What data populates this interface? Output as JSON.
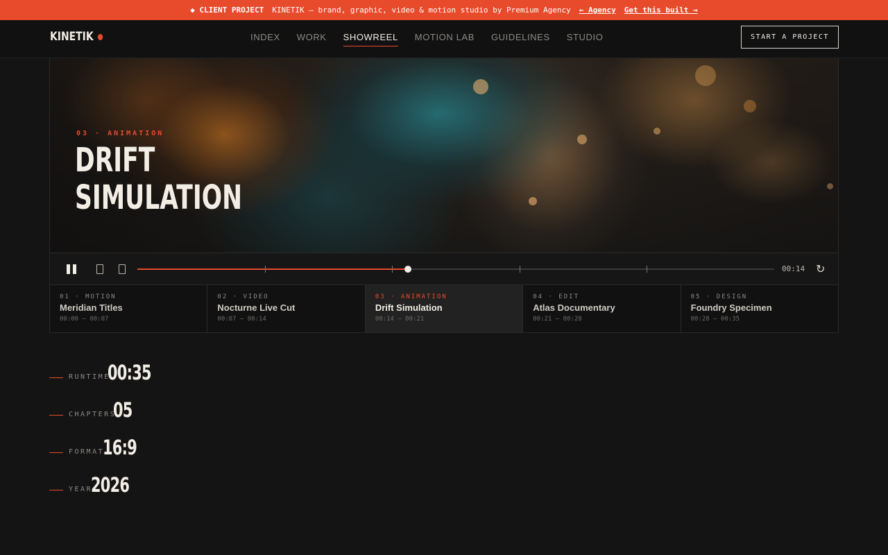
{
  "banner": {
    "tag": "◆ CLIENT PROJECT",
    "text": "KINETIK — brand, graphic, video & motion studio by Premium Agency",
    "back_link": "← Agency",
    "cta_link": "Get this built →"
  },
  "header": {
    "logo": "KINETIK",
    "nav": [
      "INDEX",
      "WORK",
      "SHOWREEL",
      "MOTION LAB",
      "GUIDELINES",
      "STUDIO"
    ],
    "active_nav": "SHOWREEL",
    "cta": "START A PROJECT"
  },
  "hero": {
    "kicker": "03 · ANIMATION",
    "title_line1": "DRIFT",
    "title_line2": "SIMULATION"
  },
  "player": {
    "timecode": "00:14",
    "loop_icon": "↻",
    "progress_fraction": 0.425
  },
  "chapters": [
    {
      "kicker": "01 · MOTION",
      "title": "Meridian Titles",
      "range": "00:00 — 00:07"
    },
    {
      "kicker": "02 · VIDEO",
      "title": "Nocturne Live Cut",
      "range": "00:07 — 00:14"
    },
    {
      "kicker": "03 · ANIMATION",
      "title": "Drift Simulation",
      "range": "00:14 — 00:21"
    },
    {
      "kicker": "04 · EDIT",
      "title": "Atlas Documentary",
      "range": "00:21 — 00:28"
    },
    {
      "kicker": "05 · DESIGN",
      "title": "Foundry Specimen",
      "range": "00:28 — 00:35"
    }
  ],
  "active_chapter": 2,
  "stats": [
    {
      "label": "RUNTIME",
      "value": "00:35"
    },
    {
      "label": "CHAPTERS",
      "value": "05"
    },
    {
      "label": "FORMAT",
      "value": "16:9"
    },
    {
      "label": "YEAR",
      "value": "2026"
    }
  ],
  "colors": {
    "accent": "#e84a2c",
    "background": "#141414"
  }
}
